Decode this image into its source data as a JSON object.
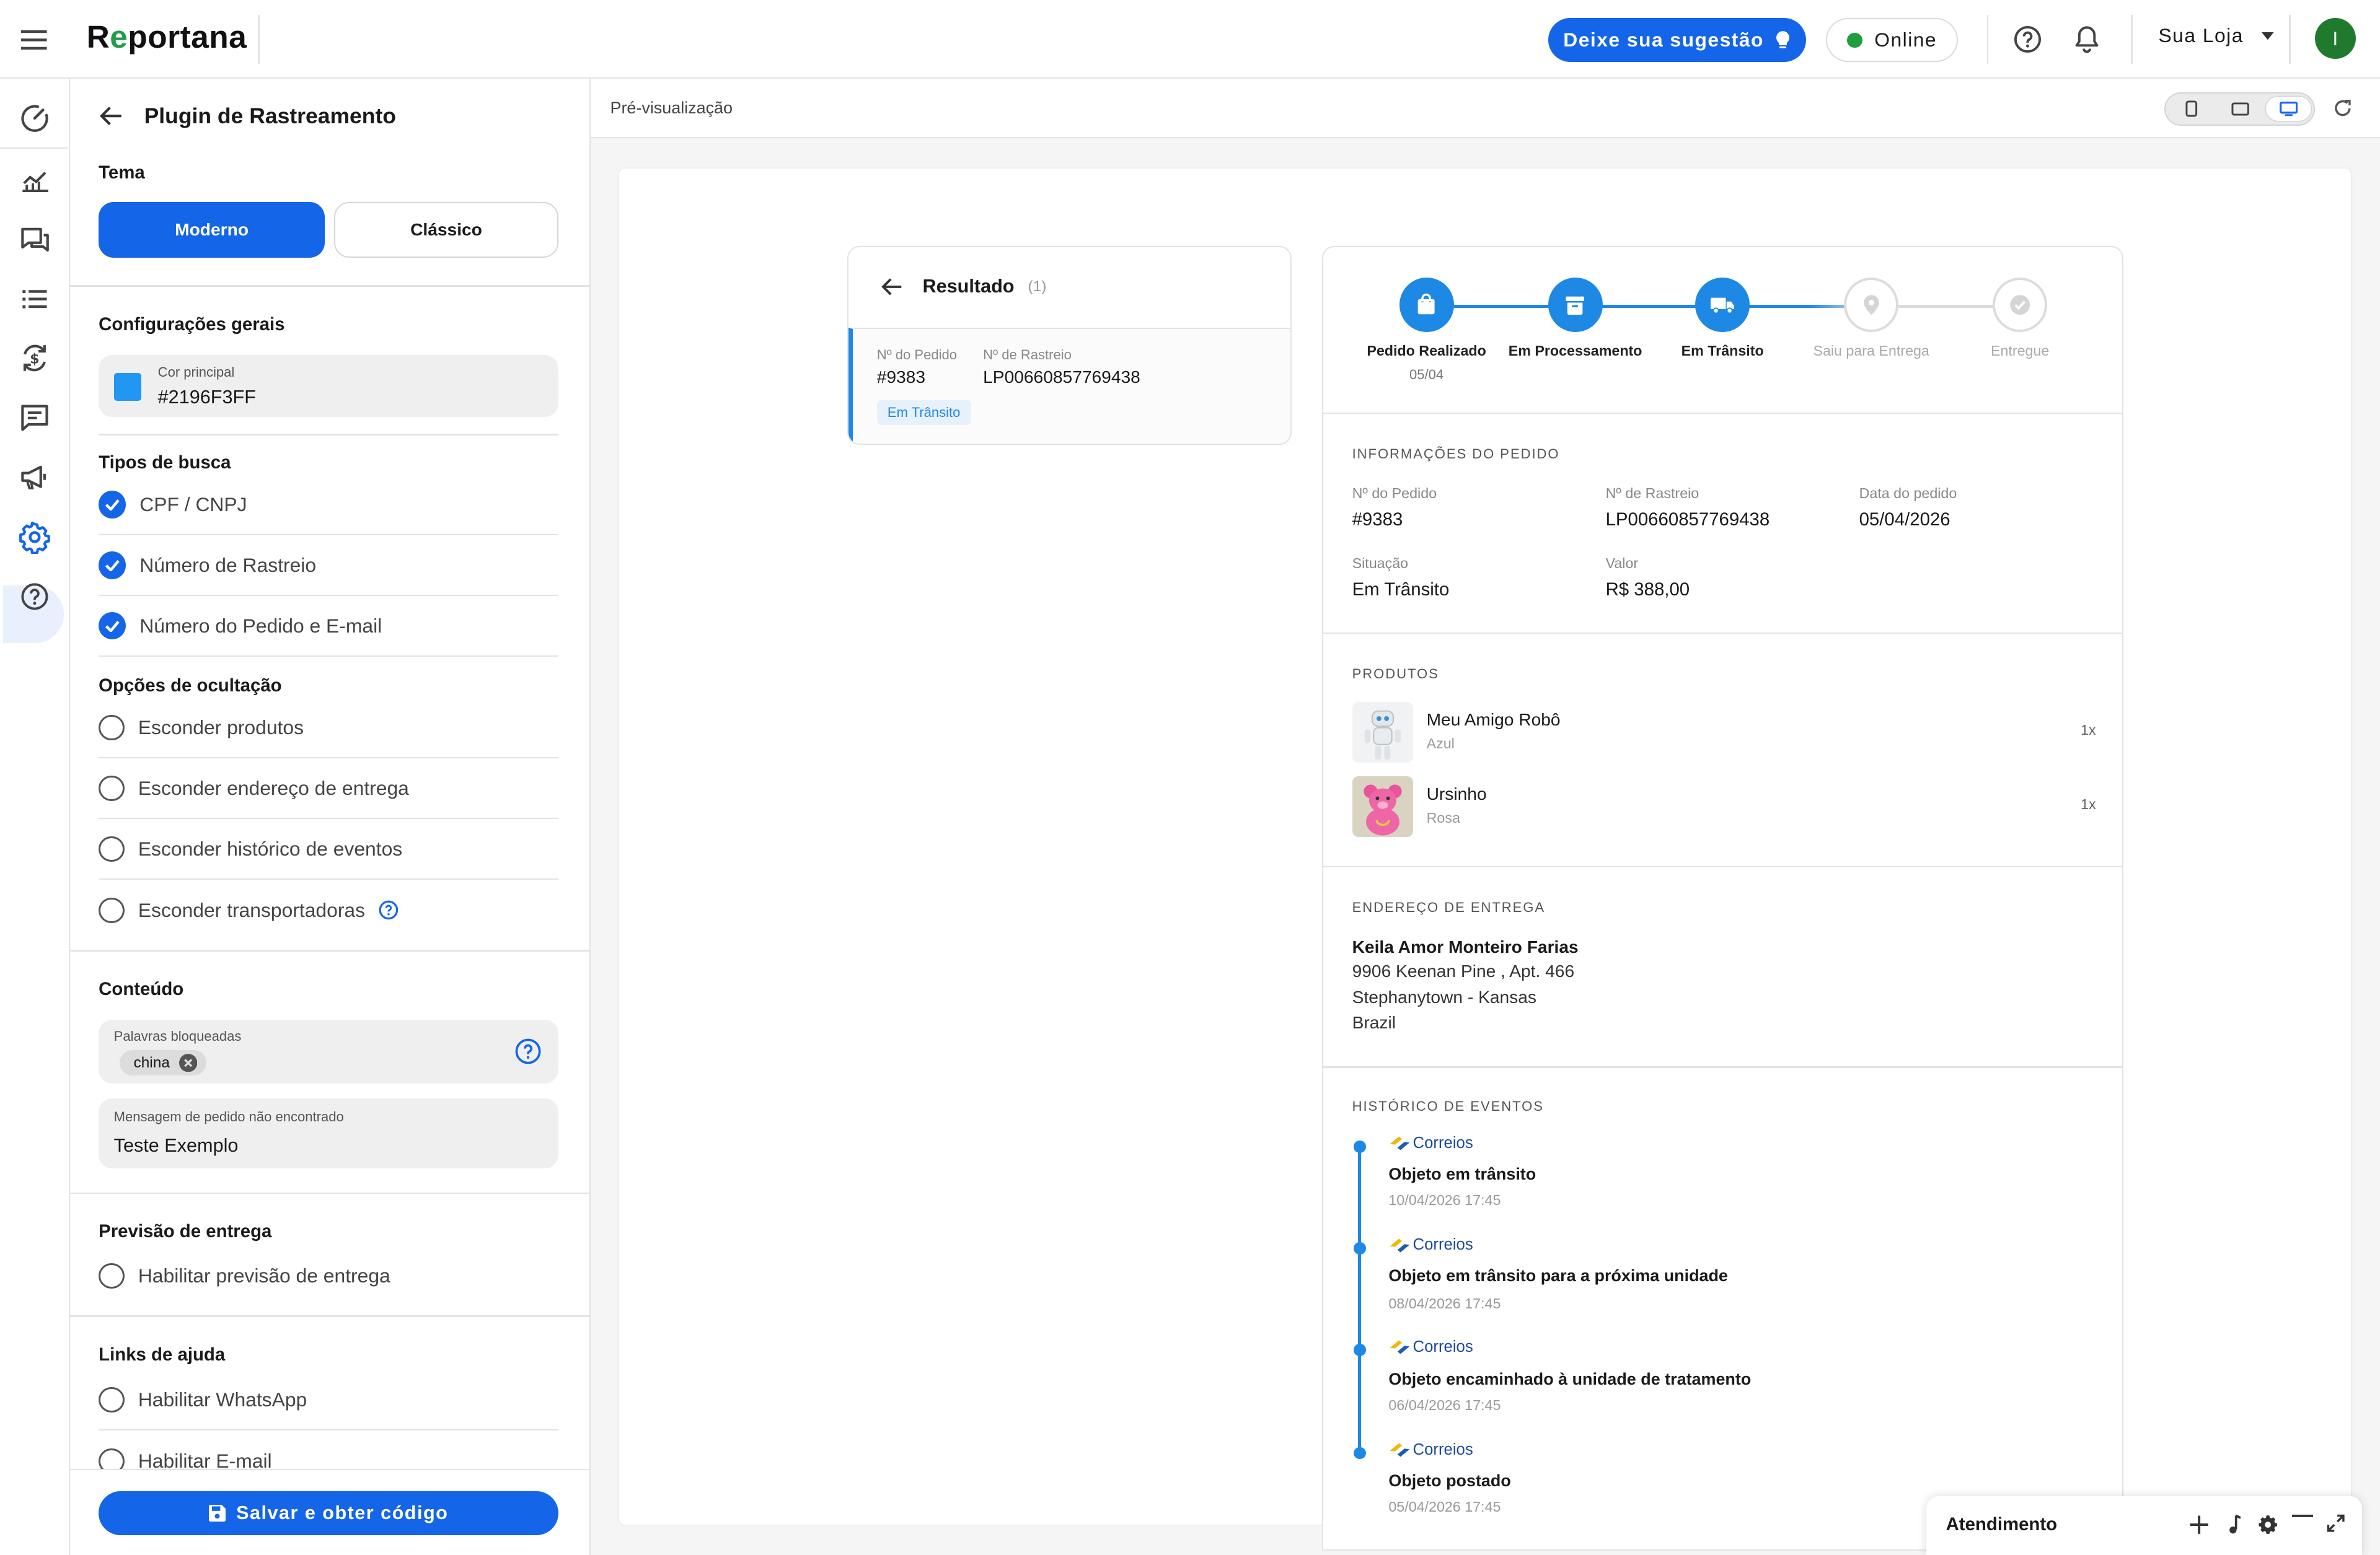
{
  "app": {
    "logo": "Reportana"
  },
  "topbar": {
    "suggest_label": "Deixe sua sugestão",
    "online_label": "Online",
    "store_label": "Sua Loja",
    "avatar_initial": "I",
    "icons": [
      "menu-icon",
      "lightbulb-icon",
      "help-icon",
      "bell-icon",
      "chevron-down-icon"
    ]
  },
  "rail": {
    "items": [
      "dashboard-icon",
      "analytics-icon",
      "chat-icon",
      "list-icon",
      "payments-icon",
      "messages-icon",
      "campaign-icon",
      "settings-icon",
      "help-icon"
    ],
    "active": "settings-icon"
  },
  "panel": {
    "title": "Plugin de Rastreamento",
    "theme": {
      "title": "Tema",
      "modern": "Moderno",
      "classic": "Clássico",
      "selected": "Moderno"
    },
    "general": {
      "title": "Configurações gerais",
      "color_label": "Cor principal",
      "color_value": "#2196F3FF"
    },
    "search_types": {
      "title": "Tipos de busca",
      "options": [
        {
          "label": "CPF / CNPJ",
          "checked": true
        },
        {
          "label": "Número de Rastreio",
          "checked": true
        },
        {
          "label": "Número do Pedido e E-mail",
          "checked": true
        }
      ]
    },
    "hide_options": {
      "title": "Opções de ocultação",
      "options": [
        {
          "label": "Esconder produtos",
          "checked": false
        },
        {
          "label": "Esconder endereço de entrega",
          "checked": false
        },
        {
          "label": "Esconder histórico de eventos",
          "checked": false
        },
        {
          "label": "Esconder transportadoras",
          "checked": false
        }
      ]
    },
    "content": {
      "title": "Conteúdo",
      "blocked_label": "Palavras bloqueadas",
      "blocked_words": [
        "china"
      ],
      "not_found_label": "Mensagem de pedido não encontrado",
      "not_found_value": "Teste Exemplo"
    },
    "delivery_forecast": {
      "title": "Previsão de entrega",
      "option": "Habilitar previsão de entrega"
    },
    "help_links": {
      "title": "Links de ajuda",
      "options": [
        "Habilitar WhatsApp",
        "Habilitar E-mail"
      ]
    },
    "save_label": "Salvar e obter código"
  },
  "preview": {
    "label": "Pré-visualização",
    "devices": [
      "mobile-icon",
      "tablet-icon",
      "desktop-icon"
    ],
    "selected_device": "desktop-icon"
  },
  "result": {
    "title": "Resultado",
    "count": "(1)",
    "order_label": "Nº do Pedido",
    "order_value": "#9383",
    "tracking_label": "Nº de Rastreio",
    "tracking_value": "LP00660857769438",
    "status_badge": "Em Trânsito"
  },
  "steps": [
    {
      "label": "Pedido Realizado",
      "date": "05/04",
      "done": true
    },
    {
      "label": "Em Processamento",
      "date": "",
      "done": true
    },
    {
      "label": "Em Trânsito",
      "date": "",
      "done": true
    },
    {
      "label": "Saiu para Entrega",
      "date": "",
      "done": false
    },
    {
      "label": "Entregue",
      "date": "",
      "done": false
    }
  ],
  "order_info": {
    "title": "INFORMAÇÕES DO PEDIDO",
    "order_label": "Nº do Pedido",
    "order_value": "#9383",
    "tracking_label": "Nº de Rastreio",
    "tracking_value": "LP00660857769438",
    "date_label": "Data do pedido",
    "date_value": "05/04/2026",
    "status_label": "Situação",
    "status_value": "Em Trânsito",
    "value_label": "Valor",
    "value_value": "R$ 388,00"
  },
  "products": {
    "title": "PRODUTOS",
    "items": [
      {
        "name": "Meu Amigo Robô",
        "variant": "Azul",
        "qty": "1x"
      },
      {
        "name": "Ursinho",
        "variant": "Rosa",
        "qty": "1x"
      }
    ]
  },
  "address": {
    "title": "ENDEREÇO DE ENTREGA",
    "name": "Keila Amor Monteiro Farias",
    "lines": [
      "9906 Keenan Pine , Apt. 466",
      "Stephanytown - Kansas",
      "Brazil"
    ]
  },
  "history": {
    "title": "HISTÓRICO DE EVENTOS",
    "events": [
      {
        "carrier": "Correios",
        "title": "Objeto em trânsito",
        "date": "10/04/2026 17:45"
      },
      {
        "carrier": "Correios",
        "title": "Objeto em trânsito para a próxima unidade",
        "date": "08/04/2026 17:45"
      },
      {
        "carrier": "Correios",
        "title": "Objeto encaminhado à unidade de tratamento",
        "date": "06/04/2026 17:45"
      },
      {
        "carrier": "Correios",
        "title": "Objeto postado",
        "date": "05/04/2026 17:45"
      }
    ]
  },
  "chat": {
    "title": "Atendimento",
    "icons": [
      "plus-icon",
      "music-note-icon",
      "gear-icon",
      "minimize-icon",
      "expand-icon"
    ]
  },
  "colors": {
    "accent": "#1565e8",
    "timeline": "#1e88e5",
    "online": "#1e9e3e",
    "avatar": "#1f7a2e"
  }
}
